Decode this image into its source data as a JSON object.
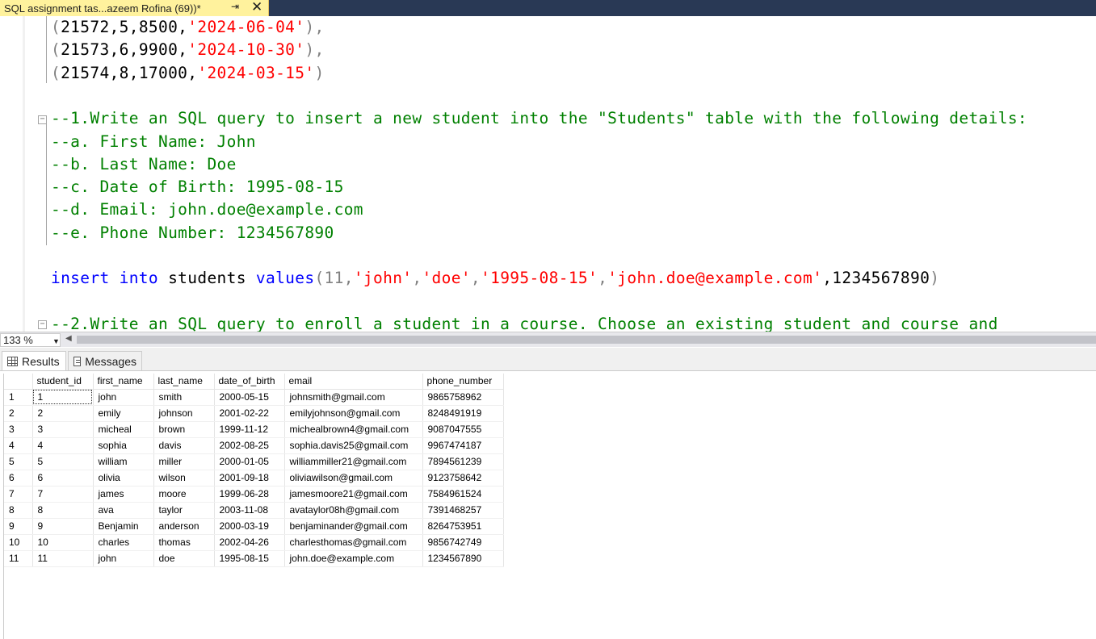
{
  "tab": {
    "title": "SQL assignment tas...azeem Rofina (69))*",
    "pin": "⇥",
    "close": "✕"
  },
  "editor": {
    "values_lines": [
      {
        "open": "(",
        "nums": "21572,5,8500,",
        "date": "'2024-06-04'",
        "close": "),"
      },
      {
        "open": "(",
        "nums": "21573,6,9900,",
        "date": "'2024-10-30'",
        "close": "),"
      },
      {
        "open": "(",
        "nums": "21574,8,17000,",
        "date": "'2024-03-15'",
        "close": ")"
      }
    ],
    "comments": [
      "--1.Write an SQL query to insert a new student into the \"Students\" table with the following details:",
      "--a. First Name: John",
      "--b. Last Name: Doe",
      "--c. Date of Birth: 1995-08-15",
      "--d. Email: john.doe@example.com",
      "--e. Phone Number: 1234567890"
    ],
    "insert": {
      "kw1": "insert into",
      "table": " students ",
      "kw2": "values",
      "p1": "(11,",
      "s1": "'john'",
      "c1": ",",
      "s2": "'doe'",
      "c2": ",",
      "s3": "'1995-08-15'",
      "c3": ",",
      "s4": "'john.doe@example.com'",
      "tail": ",1234567890",
      "close": ")"
    },
    "comment2": "--2.Write an SQL query to enroll a student in a course. Choose an existing student and course and"
  },
  "status": {
    "zoom": "133 %"
  },
  "results_tabs": {
    "results": "Results",
    "messages": "Messages"
  },
  "grid": {
    "columns": [
      "student_id",
      "first_name",
      "last_name",
      "date_of_birth",
      "email",
      "phone_number"
    ],
    "rows": [
      [
        "1",
        "1",
        "john",
        "smith",
        "2000-05-15",
        "johnsmith@gmail.com",
        "9865758962"
      ],
      [
        "2",
        "2",
        "emily",
        "johnson",
        "2001-02-22",
        "emilyjohnson@gmail.com",
        "8248491919"
      ],
      [
        "3",
        "3",
        "micheal",
        "brown",
        "1999-11-12",
        "michealbrown4@gmail.com",
        "9087047555"
      ],
      [
        "4",
        "4",
        "sophia",
        "davis",
        "2002-08-25",
        "sophia.davis25@gmail.com",
        "9967474187"
      ],
      [
        "5",
        "5",
        "william",
        "miller",
        "2000-01-05",
        "williammiller21@gmail.com",
        "7894561239"
      ],
      [
        "6",
        "6",
        "olivia",
        "wilson",
        "2001-09-18",
        "oliviawilson@gmail.com",
        "9123758642"
      ],
      [
        "7",
        "7",
        "james",
        "moore",
        "1999-06-28",
        "jamesmoore21@gmail.com",
        "7584961524"
      ],
      [
        "8",
        "8",
        "ava",
        "taylor",
        "2003-11-08",
        "avataylor08h@gmail.com",
        "7391468257"
      ],
      [
        "9",
        "9",
        "Benjamin",
        "anderson",
        "2000-03-19",
        "benjaminander@gmail.com",
        "8264753951"
      ],
      [
        "10",
        "10",
        "charles",
        "thomas",
        "2002-04-26",
        "charlesthomas@gmail.com",
        "9856742749"
      ],
      [
        "11",
        "11",
        "john",
        "doe",
        "1995-08-15",
        "john.doe@example.com",
        "1234567890"
      ]
    ]
  }
}
